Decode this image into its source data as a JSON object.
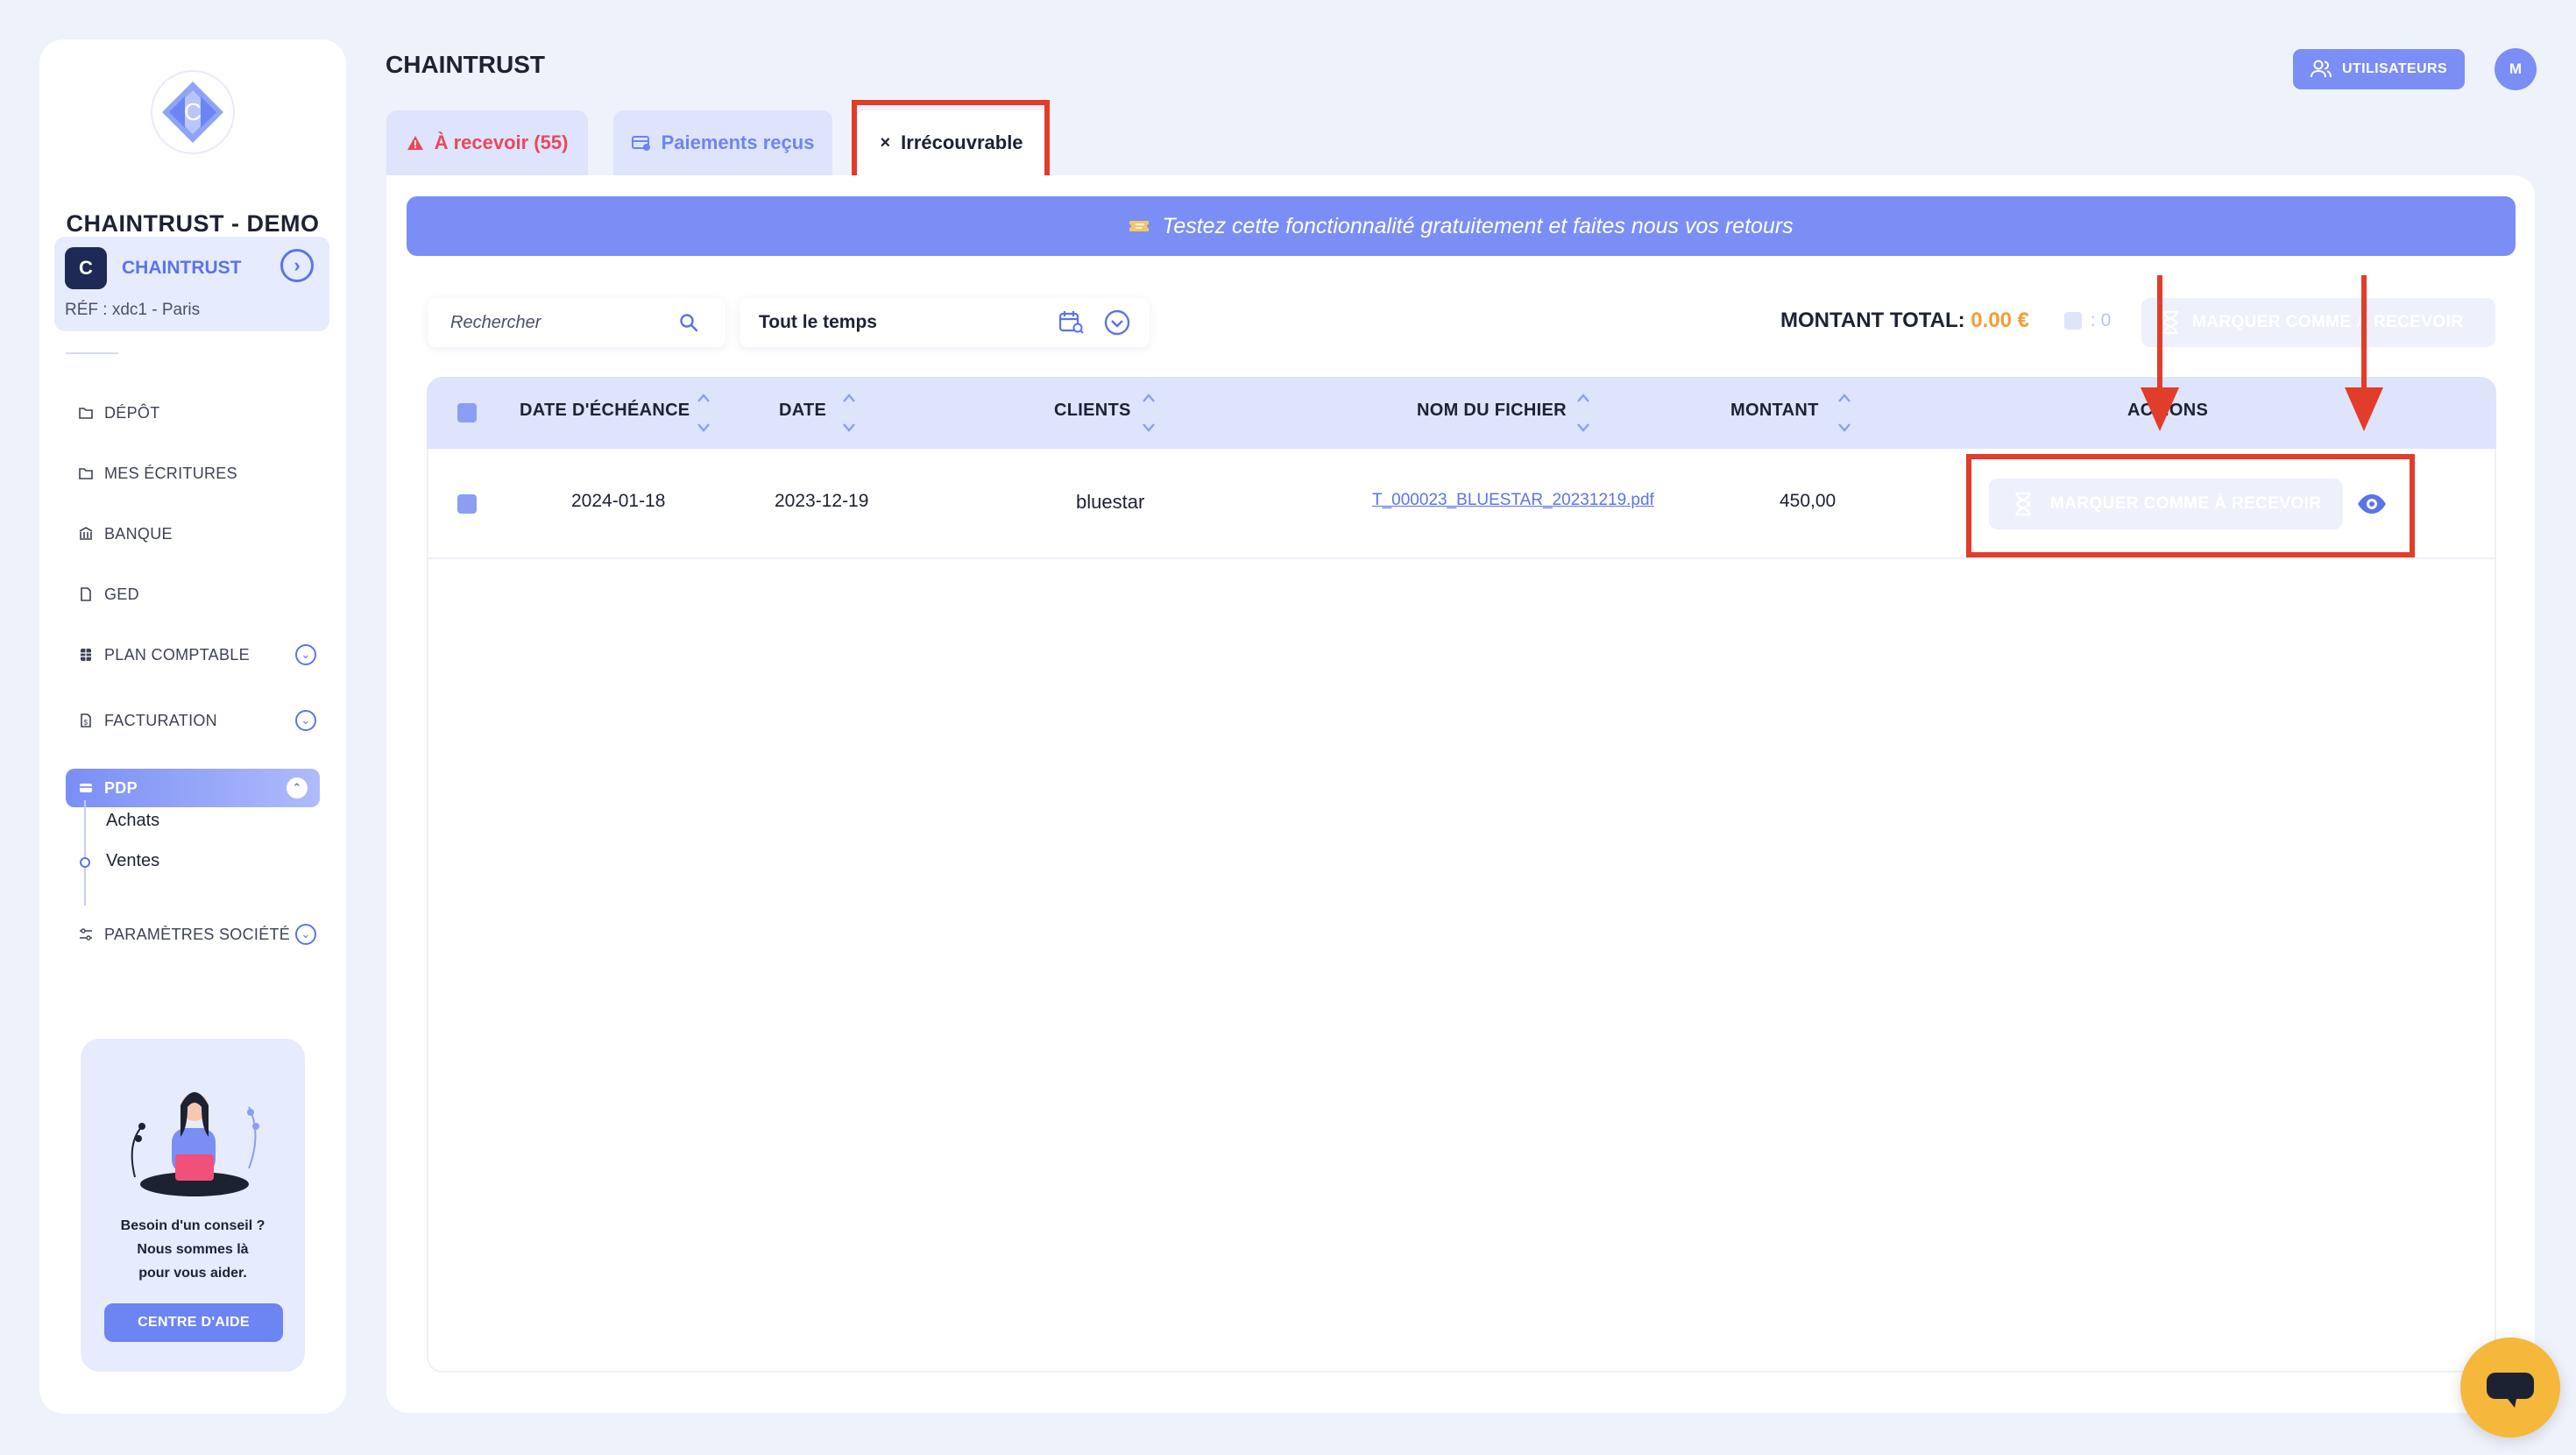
{
  "sidebar": {
    "org_name": "CHAINTRUST - DEMO",
    "company": {
      "name": "CHAINTRUST",
      "ref": "RÉF : xdc1 - Paris",
      "icon_letter": "C"
    },
    "nav": [
      {
        "label": "DÉPÔT",
        "icon": "folder-icon",
        "has_chevron": false
      },
      {
        "label": "MES ÉCRITURES",
        "icon": "folder-icon",
        "has_chevron": false
      },
      {
        "label": "BANQUE",
        "icon": "bank-icon",
        "has_chevron": false
      },
      {
        "label": "GED",
        "icon": "document-icon",
        "has_chevron": false
      },
      {
        "label": "PLAN COMPTABLE",
        "icon": "table-icon",
        "has_chevron": true
      },
      {
        "label": "FACTURATION",
        "icon": "invoice-icon",
        "has_chevron": true
      },
      {
        "label": "PDP",
        "icon": "card-icon",
        "has_chevron": true,
        "active": true
      },
      {
        "label": "PARAMÈTRES SOCIÉTÉ",
        "icon": "sliders-icon",
        "has_chevron": true
      }
    ],
    "sub_items": [
      "Achats",
      "Ventes"
    ],
    "help": {
      "line1": "Besoin d'un conseil ?",
      "line2": "Nous sommes là",
      "line3": "pour vous aider.",
      "button": "CENTRE D'AIDE"
    }
  },
  "header": {
    "title": "CHAINTRUST",
    "users_button": "UTILISATEURS",
    "avatar_letter": "M"
  },
  "tabs": [
    {
      "label": "À recevoir (55)",
      "icon": "warning-icon",
      "color": "#e8485a"
    },
    {
      "label": "Paiements reçus",
      "icon": "payment-icon",
      "color": "#6d85f2"
    },
    {
      "label": "Irrécouvrable",
      "icon": "close-icon",
      "active": true
    }
  ],
  "banner": {
    "text": "Testez cette fonctionnalité gratuitement et faites nous vos retours",
    "icon": "ticket-icon"
  },
  "filters": {
    "search_placeholder": "Rechercher",
    "period_value": "Tout le temps",
    "total_label": "MONTANT TOTAL:",
    "total_value": "0.00 €",
    "selected_count": ": 0",
    "bulk_button": "MARQUER COMME À RECEVOIR"
  },
  "table": {
    "columns": [
      "DATE D'ÉCHÉANCE",
      "DATE",
      "CLIENTS",
      "NOM DU FICHIER",
      "MONTANT",
      "ACTIONS"
    ],
    "rows": [
      {
        "due_date": "2024-01-18",
        "date": "2023-12-19",
        "client": "bluestar",
        "file": "T_000023_BLUESTAR_20231219.pdf",
        "amount": "450,00",
        "action_button": "MARQUER COMME À RECEVOIR"
      }
    ]
  },
  "colors": {
    "accent": "#7b8ef5",
    "primary": "#5b74e8",
    "warning": "#e8485a",
    "total": "#f29c38",
    "annotation": "#e23c2a",
    "chat": "#f5b83a"
  }
}
